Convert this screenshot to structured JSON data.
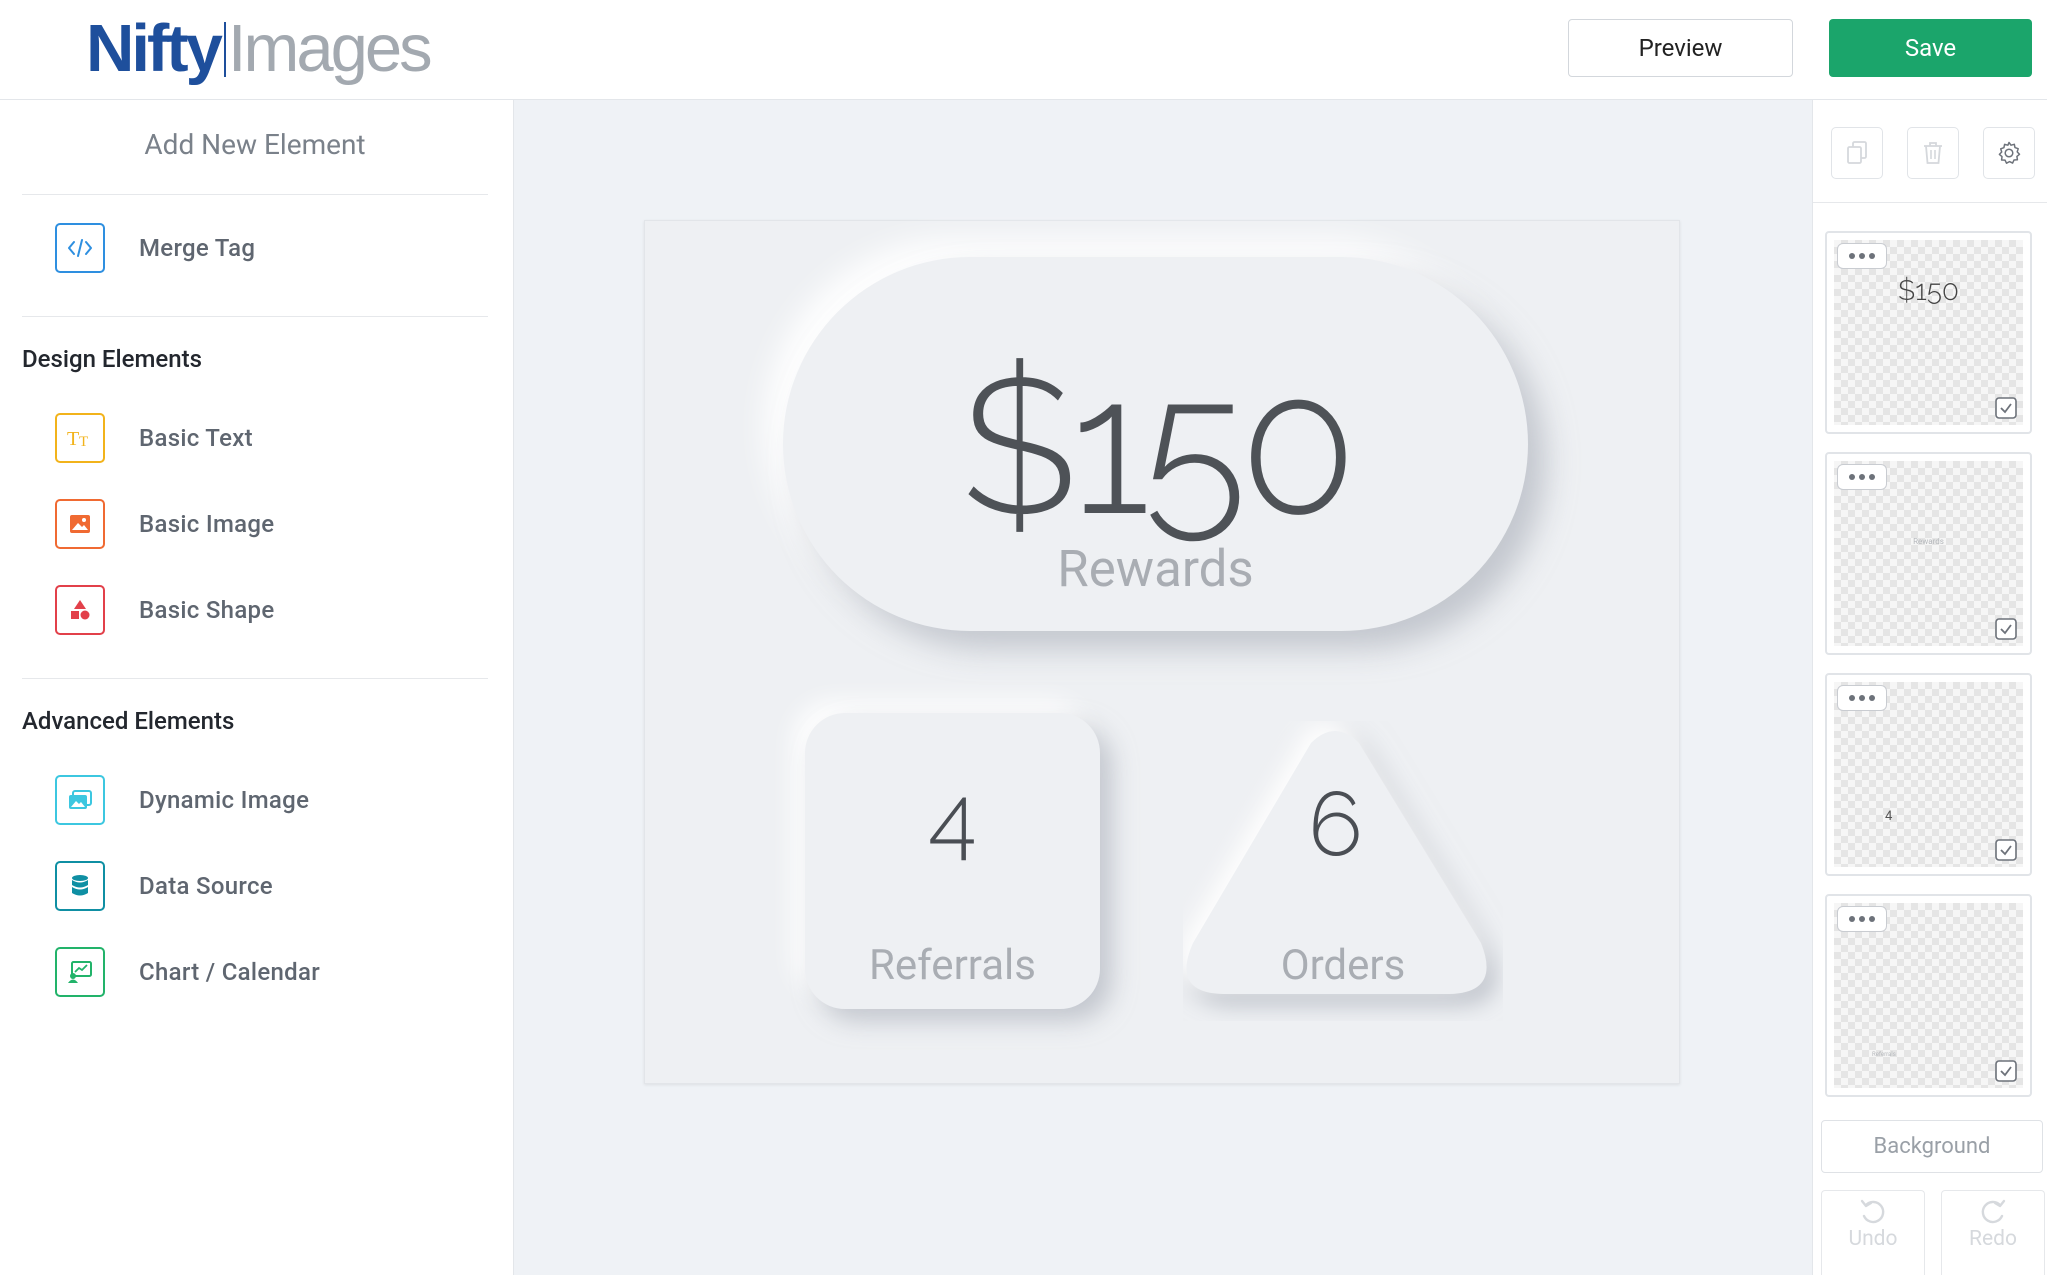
{
  "header": {
    "logo_part1": "Nifty",
    "logo_part2": "Images",
    "preview_label": "Preview",
    "save_label": "Save"
  },
  "sidebar": {
    "title": "Add New Element",
    "merge_tag": {
      "label": "Merge Tag",
      "icon": "code-icon",
      "color": "#2e8fe0"
    },
    "design_section": "Design Elements",
    "design_items": [
      {
        "label": "Basic Text",
        "icon": "text-icon",
        "color": "#f2b31b"
      },
      {
        "label": "Basic Image",
        "icon": "image-icon",
        "color": "#f06a32"
      },
      {
        "label": "Basic Shape",
        "icon": "shapes-icon",
        "color": "#e2404a"
      }
    ],
    "advanced_section": "Advanced Elements",
    "advanced_items": [
      {
        "label": "Dynamic Image",
        "icon": "dynamic-image-icon",
        "color": "#3cc7e0"
      },
      {
        "label": "Data Source",
        "icon": "database-icon",
        "color": "#0f8fa3"
      },
      {
        "label": "Chart / Calendar",
        "icon": "chart-icon",
        "color": "#22b36a"
      }
    ]
  },
  "canvas": {
    "rewards_value": "$150",
    "rewards_label": "Rewards",
    "referrals_value": "4",
    "referrals_label": "Referrals",
    "orders_value": "6",
    "orders_label": "Orders"
  },
  "right_panel": {
    "tools": [
      "copy-icon",
      "trash-icon",
      "gear-icon"
    ],
    "layers": [
      {
        "text": "$150"
      },
      {
        "text": "Rewards"
      },
      {
        "text": "4"
      },
      {
        "text": "Referrals"
      }
    ],
    "background_label": "Background",
    "undo_label": "Undo",
    "redo_label": "Redo"
  },
  "colors": {
    "brand_blue": "#1e4f9c",
    "save_green": "#1ba56b",
    "canvas_bg": "#eff2f6"
  }
}
